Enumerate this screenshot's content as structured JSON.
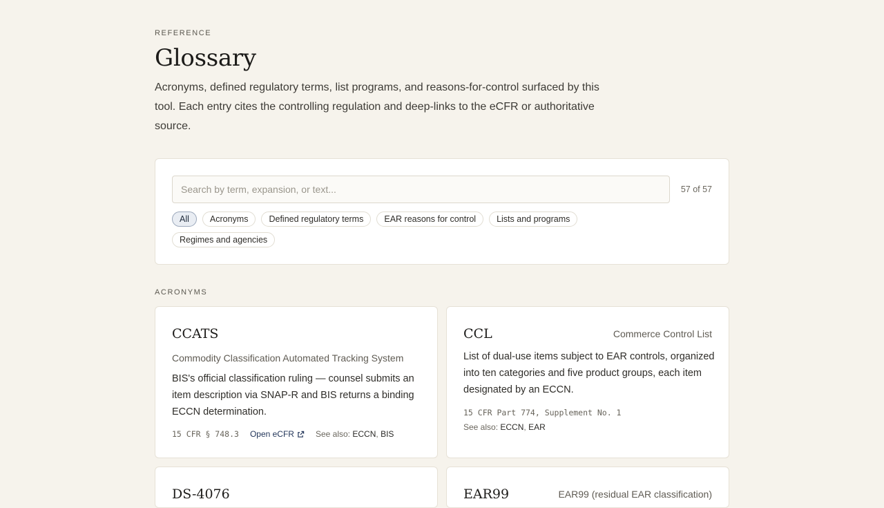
{
  "header": {
    "eyebrow": "REFERENCE",
    "title": "Glossary",
    "intro": "Acronyms, defined regulatory terms, list programs, and reasons-for-control surfaced by this tool. Each entry cites the controlling regulation and deep-links to the eCFR or authoritative source."
  },
  "filters": {
    "search_placeholder": "Search by term, expansion, or text...",
    "search_value": "",
    "count": "57 of 57",
    "chips": [
      {
        "label": "All",
        "active": true
      },
      {
        "label": "Acronyms",
        "active": false
      },
      {
        "label": "Defined regulatory terms",
        "active": false
      },
      {
        "label": "EAR reasons for control",
        "active": false
      },
      {
        "label": "Lists and programs",
        "active": false
      },
      {
        "label": "Regimes and agencies",
        "active": false
      }
    ]
  },
  "section": {
    "label": "ACRONYMS"
  },
  "cards": [
    {
      "term": "CCATS",
      "expansion": "Commodity Classification Automated Tracking System",
      "definition": "BIS's official classification ruling — counsel submits an item description via SNAP-R and BIS returns a binding ECCN determination.",
      "citation": "15 CFR § 748.3",
      "link_label": "Open eCFR",
      "see_also_label": "See also:",
      "see_also": [
        "ECCN",
        "BIS"
      ]
    },
    {
      "term": "CCL",
      "expansion": "Commerce Control List",
      "definition": "List of dual-use items subject to EAR controls, organized into ten categories and five product groups, each item designated by an ECCN.",
      "citation": "15 CFR Part 774, Supplement No. 1",
      "see_also_label": "See also:",
      "see_also": [
        "ECCN",
        "EAR"
      ]
    },
    {
      "term": "DS-4076",
      "expansion": ""
    },
    {
      "term": "EAR99",
      "expansion": "EAR99 (residual EAR classification)"
    }
  ],
  "icons": {
    "external_link": "external-link-icon"
  },
  "colors": {
    "background": "#f6f3ec",
    "link": "#23365a",
    "active_chip_bg": "#e9edf3"
  }
}
